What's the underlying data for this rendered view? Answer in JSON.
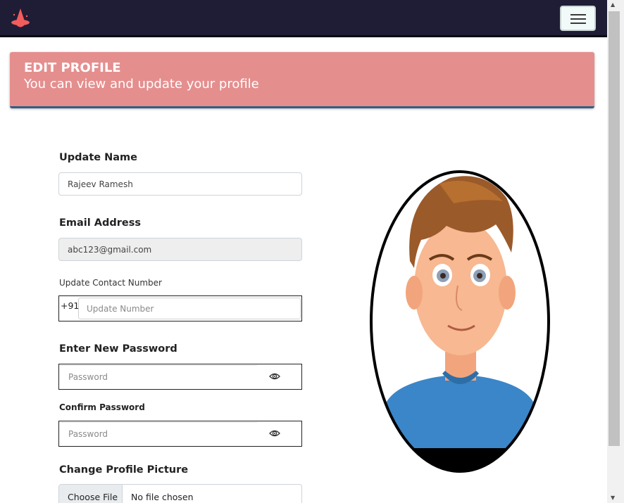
{
  "navbar": {
    "logo_icon": "flame-hat-logo-icon",
    "toggle_icon": "hamburger-menu-icon"
  },
  "banner": {
    "title": "EDIT PROFILE",
    "subtitle": "You can view and update your profile"
  },
  "form": {
    "name_label": "Update Name",
    "name_value": "Rajeev Ramesh",
    "email_label": "Email Address",
    "email_value": "abc123@gmail.com",
    "contact_label": "Update Contact Number",
    "contact_prefix": "+91",
    "contact_placeholder": "Update Number",
    "new_password_label": "Enter New Password",
    "new_password_placeholder": "Password",
    "confirm_password_label": "Confirm Password",
    "confirm_password_placeholder": "Password",
    "picture_label": "Change Profile Picture",
    "file_button": "Choose File",
    "file_status": "No file chosen",
    "eye_icon": "eye-icon"
  },
  "colors": {
    "navbar_bg": "#1f1c35",
    "banner_bg": "#e58e8e",
    "banner_border": "#2e5f82",
    "logo_accent": "#f25c5c"
  }
}
